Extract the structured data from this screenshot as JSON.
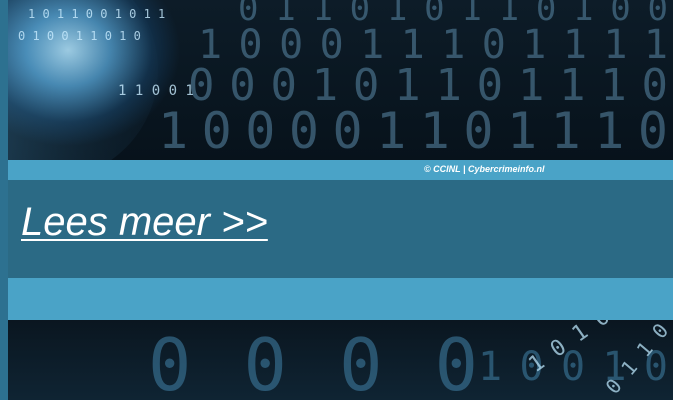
{
  "hero_top": {
    "image_description_icon": "binary-code-image"
  },
  "caption": {
    "text": "© CCINL | Cybercrimeinfo.nl"
  },
  "read_more": {
    "label": "Lees meer >>"
  },
  "hero_bottom": {
    "image_description_icon": "binary-code-image"
  },
  "colors": {
    "page_background": "#2b6a85",
    "accent_bar": "#4aa3c7",
    "link_text": "#ffffff"
  }
}
